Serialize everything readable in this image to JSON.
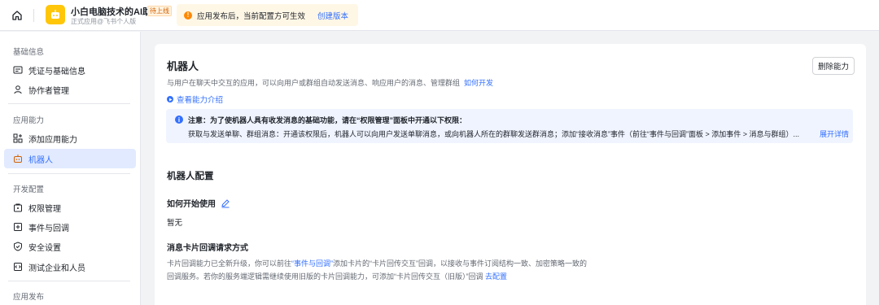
{
  "header": {
    "app_name": "小白电脑技术的AI助手",
    "app_badge": "待上线",
    "app_subtitle": "正式应用@飞书个人版",
    "notice_text": "应用发布后，当前配置方可生效",
    "notice_link": "创建版本"
  },
  "sidebar": {
    "groups": [
      {
        "title": "基础信息",
        "items": [
          {
            "label": "凭证与基础信息",
            "icon": "credential-icon"
          },
          {
            "label": "协作者管理",
            "icon": "user-icon"
          }
        ]
      },
      {
        "title": "应用能力",
        "items": [
          {
            "label": "添加应用能力",
            "icon": "add-ability-icon"
          },
          {
            "label": "机器人",
            "icon": "robot-icon",
            "active": true
          }
        ]
      },
      {
        "title": "开发配置",
        "items": [
          {
            "label": "权限管理",
            "icon": "permission-icon"
          },
          {
            "label": "事件与回调",
            "icon": "event-icon"
          },
          {
            "label": "安全设置",
            "icon": "shield-icon"
          },
          {
            "label": "测试企业和人员",
            "icon": "test-icon"
          }
        ]
      },
      {
        "title": "应用发布",
        "items": []
      }
    ]
  },
  "main": {
    "title": "机器人",
    "description": "与用户在聊天中交互的应用，可以向用户或群组自动发送消息、响应用户的消息、管理群组",
    "description_link": "如何开发",
    "delete_button": "删除能力",
    "intro_link": "查看能力介绍",
    "info": {
      "title": "注意：为了使机器人具有收发消息的基础功能，请在“权限管理”面板中开通以下权限：",
      "body": "获取与发送单聊、群组消息：开通该权限后，机器人可以向用户发送单聊消息，或向机器人所在的群聊发送群消息；添加“接收消息”事件（前往“事件与回调”面板 > 添加事件 > 消息与群组）...",
      "expand": "展开详情"
    },
    "config_title": "机器人配置",
    "howto_title": "如何开始使用",
    "howto_value": "暂无",
    "callback_title": "消息卡片回调请求方式",
    "callback_desc_1": "卡片回调能力已全新升级，你可以前往",
    "callback_desc_link": "“事件与回调”",
    "callback_desc_2": "添加卡片的“卡片回传交互”回调，以接收与事件订阅结构一致、加密策略一致的回调服务。若你的服务端逻辑需继续使用旧版的卡片回调能力，可添加“卡片回传交互（旧版）”回调",
    "callback_config_link": "去配置"
  },
  "colors": {
    "accent": "#3370ff",
    "warning": "#ff8800",
    "active_bg": "#e1eaff",
    "app_avatar": "#ffc60a"
  }
}
